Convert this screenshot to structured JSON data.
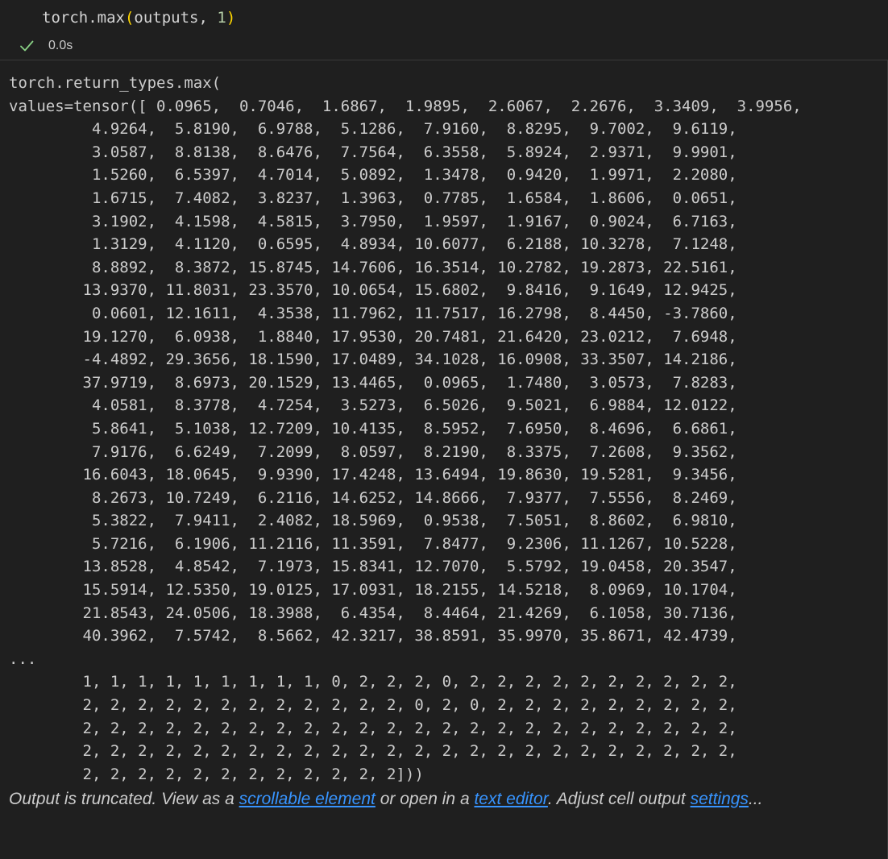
{
  "cell": {
    "code": {
      "fn": "torch.max",
      "open_paren": "(",
      "args": "outputs, ",
      "num": "1",
      "close_paren": ")"
    },
    "status": {
      "exec_time": "0.0s",
      "icon": "check-icon",
      "success_color": "#89d185"
    }
  },
  "output": {
    "lines": [
      "torch.return_types.max(",
      "values=tensor([ 0.0965,  0.7046,  1.6867,  1.9895,  2.6067,  2.2676,  3.3409,  3.9956,",
      "         4.9264,  5.8190,  6.9788,  5.1286,  7.9160,  8.8295,  9.7002,  9.6119,",
      "         3.0587,  8.8138,  8.6476,  7.7564,  6.3558,  5.8924,  2.9371,  9.9901,",
      "         1.5260,  6.5397,  4.7014,  5.0892,  1.3478,  0.9420,  1.9971,  2.2080,",
      "         1.6715,  7.4082,  3.8237,  1.3963,  0.7785,  1.6584,  1.8606,  0.0651,",
      "         3.1902,  4.1598,  4.5815,  3.7950,  1.9597,  1.9167,  0.9024,  6.7163,",
      "         1.3129,  4.1120,  0.6595,  4.8934, 10.6077,  6.2188, 10.3278,  7.1248,",
      "         8.8892,  8.3872, 15.8745, 14.7606, 16.3514, 10.2782, 19.2873, 22.5161,",
      "        13.9370, 11.8031, 23.3570, 10.0654, 15.6802,  9.8416,  9.1649, 12.9425,",
      "         0.0601, 12.1611,  4.3538, 11.7962, 11.7517, 16.2798,  8.4450, -3.7860,",
      "        19.1270,  6.0938,  1.8840, 17.9530, 20.7481, 21.6420, 23.0212,  7.6948,",
      "        -4.4892, 29.3656, 18.1590, 17.0489, 34.1028, 16.0908, 33.3507, 14.2186,",
      "        37.9719,  8.6973, 20.1529, 13.4465,  0.0965,  1.7480,  3.0573,  7.8283,",
      "         4.0581,  8.3778,  4.7254,  3.5273,  6.5026,  9.5021,  6.9884, 12.0122,",
      "         5.8641,  5.1038, 12.7209, 10.4135,  8.5952,  7.6950,  8.4696,  6.6861,",
      "         7.9176,  6.6249,  7.2099,  8.0597,  8.2190,  8.3375,  7.2608,  9.3562,",
      "        16.6043, 18.0645,  9.9390, 17.4248, 13.6494, 19.8630, 19.5281,  9.3456,",
      "         8.2673, 10.7249,  6.2116, 14.6252, 14.8666,  7.9377,  7.5556,  8.2469,",
      "         5.3822,  7.9411,  2.4082, 18.5969,  0.9538,  7.5051,  8.8602,  6.9810,",
      "         5.7216,  6.1906, 11.2116, 11.3591,  7.8477,  9.2306, 11.1267, 10.5228,",
      "        13.8528,  4.8542,  7.1973, 15.8341, 12.7070,  5.5792, 19.0458, 20.3547,",
      "        15.5914, 12.5350, 19.0125, 17.0931, 18.2155, 14.5218,  8.0969, 10.1704,",
      "        21.8543, 24.0506, 18.3988,  6.4354,  8.4464, 21.4269,  6.1058, 30.7136,",
      "        40.3962,  7.5742,  8.5662, 42.3217, 38.8591, 35.9970, 35.8671, 42.4739,",
      "...",
      "        1, 1, 1, 1, 1, 1, 1, 1, 1, 0, 2, 2, 2, 0, 2, 2, 2, 2, 2, 2, 2, 2, 2, 2,",
      "        2, 2, 2, 2, 2, 2, 2, 2, 2, 2, 2, 2, 0, 2, 0, 2, 2, 2, 2, 2, 2, 2, 2, 2,",
      "        2, 2, 2, 2, 2, 2, 2, 2, 2, 2, 2, 2, 2, 2, 2, 2, 2, 2, 2, 2, 2, 2, 2, 2,",
      "        2, 2, 2, 2, 2, 2, 2, 2, 2, 2, 2, 2, 2, 2, 2, 2, 2, 2, 2, 2, 2, 2, 2, 2,",
      "        2, 2, 2, 2, 2, 2, 2, 2, 2, 2, 2, 2]))"
    ],
    "truncation": {
      "t1": "Output is truncated. View as a ",
      "link_scrollable": "scrollable element",
      "t2": " or open in a ",
      "link_editor": "text editor",
      "t3": ". Adjust cell output ",
      "link_settings": "settings",
      "t4": "..."
    }
  },
  "colors": {
    "background": "#1f1f1f",
    "text": "#cccccc",
    "link": "#3794ff",
    "bracket": "#ffd700",
    "number_literal": "#b5cea8"
  }
}
